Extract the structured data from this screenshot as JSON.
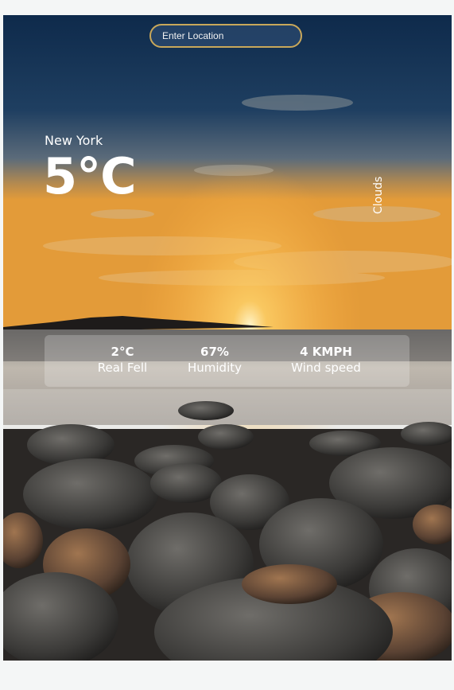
{
  "search": {
    "placeholder": "Enter Location"
  },
  "weather": {
    "city": "New York",
    "temperature": "5°C",
    "condition": "Clouds"
  },
  "stats": [
    {
      "value": "2°C",
      "label": "Real Fell"
    },
    {
      "value": "67%",
      "label": "Humidity"
    },
    {
      "value": "4 KMPH",
      "label": "Wind speed"
    }
  ],
  "colors": {
    "search_border": "#c9a85a",
    "sky_top": "#0f2b4d",
    "sunset": "#f0a640"
  },
  "icons": [
    "search-input"
  ]
}
